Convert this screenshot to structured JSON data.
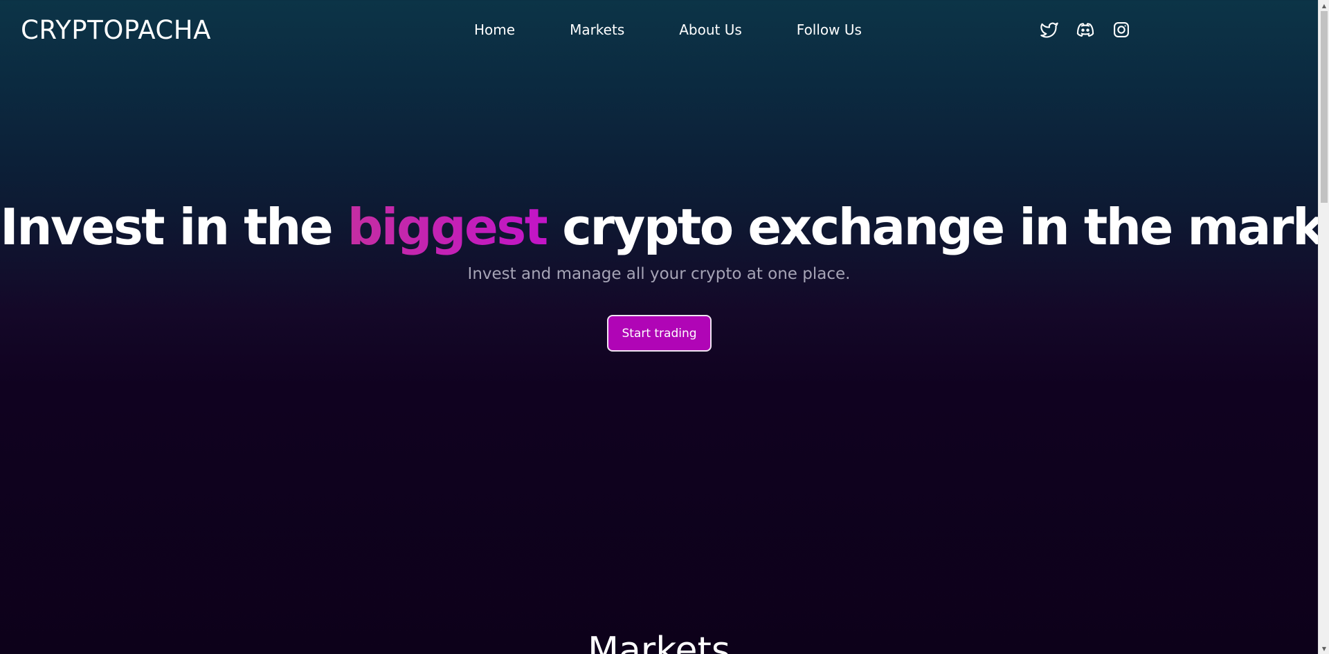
{
  "brand": {
    "name": "CRYPTOPACHA"
  },
  "nav": {
    "links": [
      {
        "label": "Home"
      },
      {
        "label": "Markets"
      },
      {
        "label": "About Us"
      },
      {
        "label": "Follow Us"
      }
    ]
  },
  "socials": [
    {
      "icon": "twitter-icon"
    },
    {
      "icon": "discord-icon"
    },
    {
      "icon": "instagram-icon"
    }
  ],
  "hero": {
    "headline_before": "Invest in the ",
    "headline_accent": "biggest",
    "headline_after": " crypto exchange in the market",
    "subline": "Invest and manage all your crypto at one place.",
    "cta_label": "Start trading"
  },
  "markets": {
    "heading": "Markets"
  },
  "colors": {
    "accent": "#b005b6",
    "accent_text_start": "#c42ea2",
    "accent_text_end": "#c215c7",
    "background_top": "#0c3447",
    "background_bottom": "#0d011a",
    "subline": "#a6a4b6"
  },
  "scrollbar": {
    "position_fraction": 0.0
  }
}
